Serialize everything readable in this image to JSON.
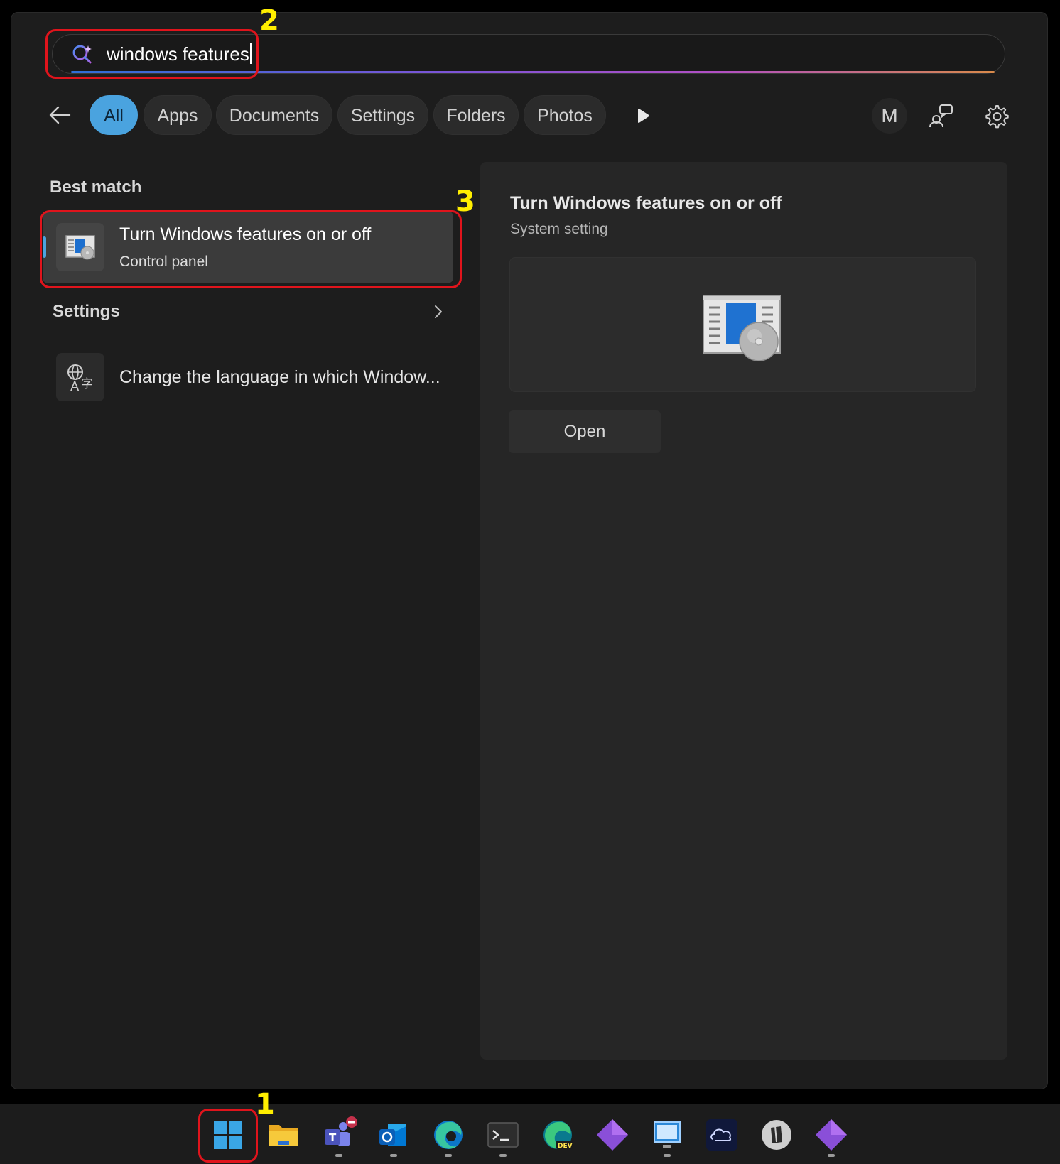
{
  "search": {
    "query": "windows features"
  },
  "filters": {
    "tabs": [
      "All",
      "Apps",
      "Documents",
      "Settings",
      "Folders",
      "Photos"
    ],
    "account_initial": "M"
  },
  "best_match": {
    "heading": "Best match",
    "title": "Turn Windows features on or off",
    "subtitle": "Control panel"
  },
  "settings_section": {
    "heading": "Settings",
    "item": "Change the language in which Window..."
  },
  "detail": {
    "title": "Turn Windows features on or off",
    "subtitle": "System setting",
    "open_label": "Open"
  },
  "annotations": [
    "1",
    "2",
    "3"
  ],
  "taskbar": {
    "items": [
      "start-icon",
      "file-explorer-icon",
      "teams-icon",
      "outlook-icon",
      "edge-icon",
      "terminal-icon",
      "edge-dev-icon",
      "purple-app-icon",
      "remote-desktop-icon",
      "cloud-app-icon",
      "linux-app-icon",
      "purple-app-2-icon"
    ]
  },
  "colors": {
    "accent": "#4aa3df",
    "highlight": "#e0141c",
    "annotation": "#ffee00",
    "panel": "#1d1d1d"
  }
}
